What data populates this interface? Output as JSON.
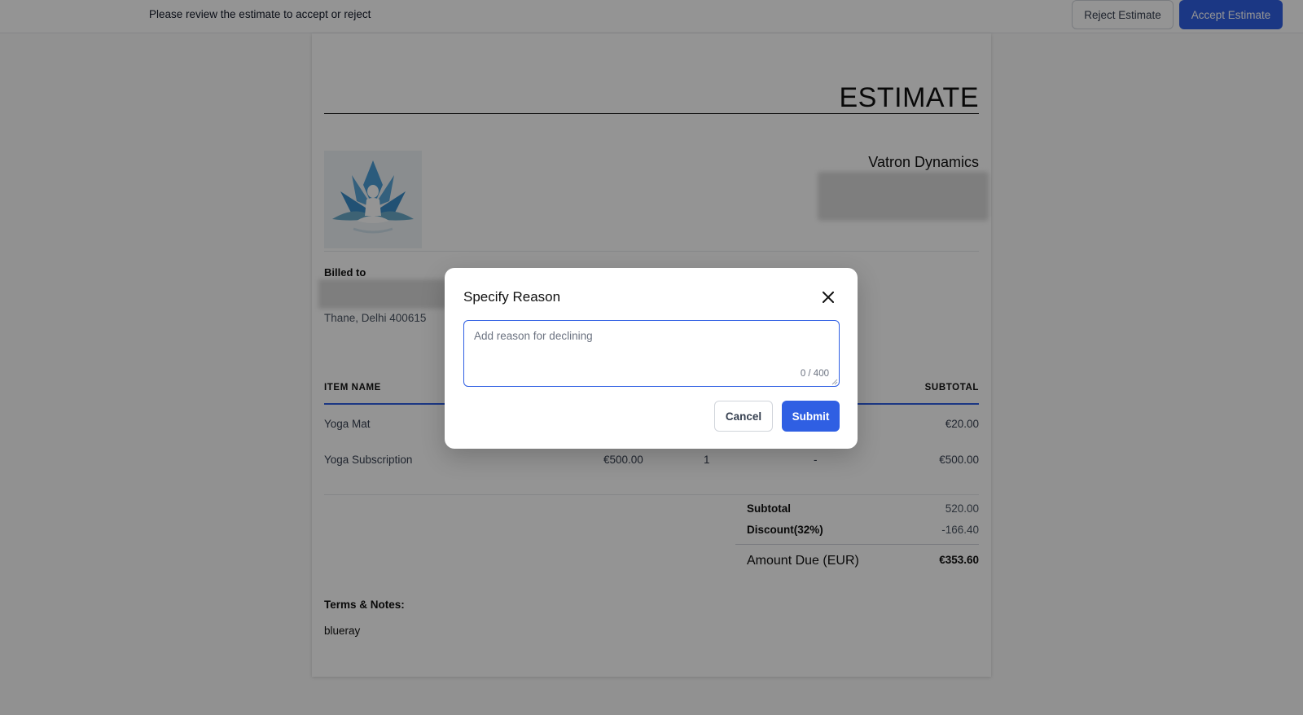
{
  "topbar": {
    "message": "Please review the estimate to accept or reject",
    "reject_label": "Reject Estimate",
    "accept_label": "Accept Estimate"
  },
  "estimate": {
    "title": "ESTIMATE",
    "company_name": "Vatron Dynamics",
    "billed_to_label": "Billed to",
    "billed_address": "Thane, Delhi 400615",
    "table": {
      "headers": {
        "item_name": "ITEM NAME",
        "subtotal": "SUBTOTAL"
      },
      "rows": [
        {
          "name": "Yoga Mat",
          "price": "",
          "qty": "",
          "discount": "",
          "subtotal": "€20.00"
        },
        {
          "name": "Yoga Subscription",
          "price": "€500.00",
          "qty": "1",
          "discount": "-",
          "subtotal": "€500.00"
        }
      ]
    },
    "totals": {
      "subtotal_label": "Subtotal",
      "subtotal_value": "520.00",
      "discount_label": "Discount(32%)",
      "discount_value": "-166.40",
      "amount_due_label": "Amount Due (EUR)",
      "amount_due_value": "€353.60"
    },
    "terms_label": "Terms & Notes:",
    "terms_text": "blueray"
  },
  "modal": {
    "title": "Specify Reason",
    "placeholder": "Add reason for declining",
    "counter": "0 / 400",
    "cancel_label": "Cancel",
    "submit_label": "Submit"
  },
  "colors": {
    "accent": "#2f5fe3",
    "overlay": "rgba(0,0,0,0.42)"
  },
  "icons": {
    "close": "close-icon",
    "logo": "lotus-meditation-logo"
  }
}
